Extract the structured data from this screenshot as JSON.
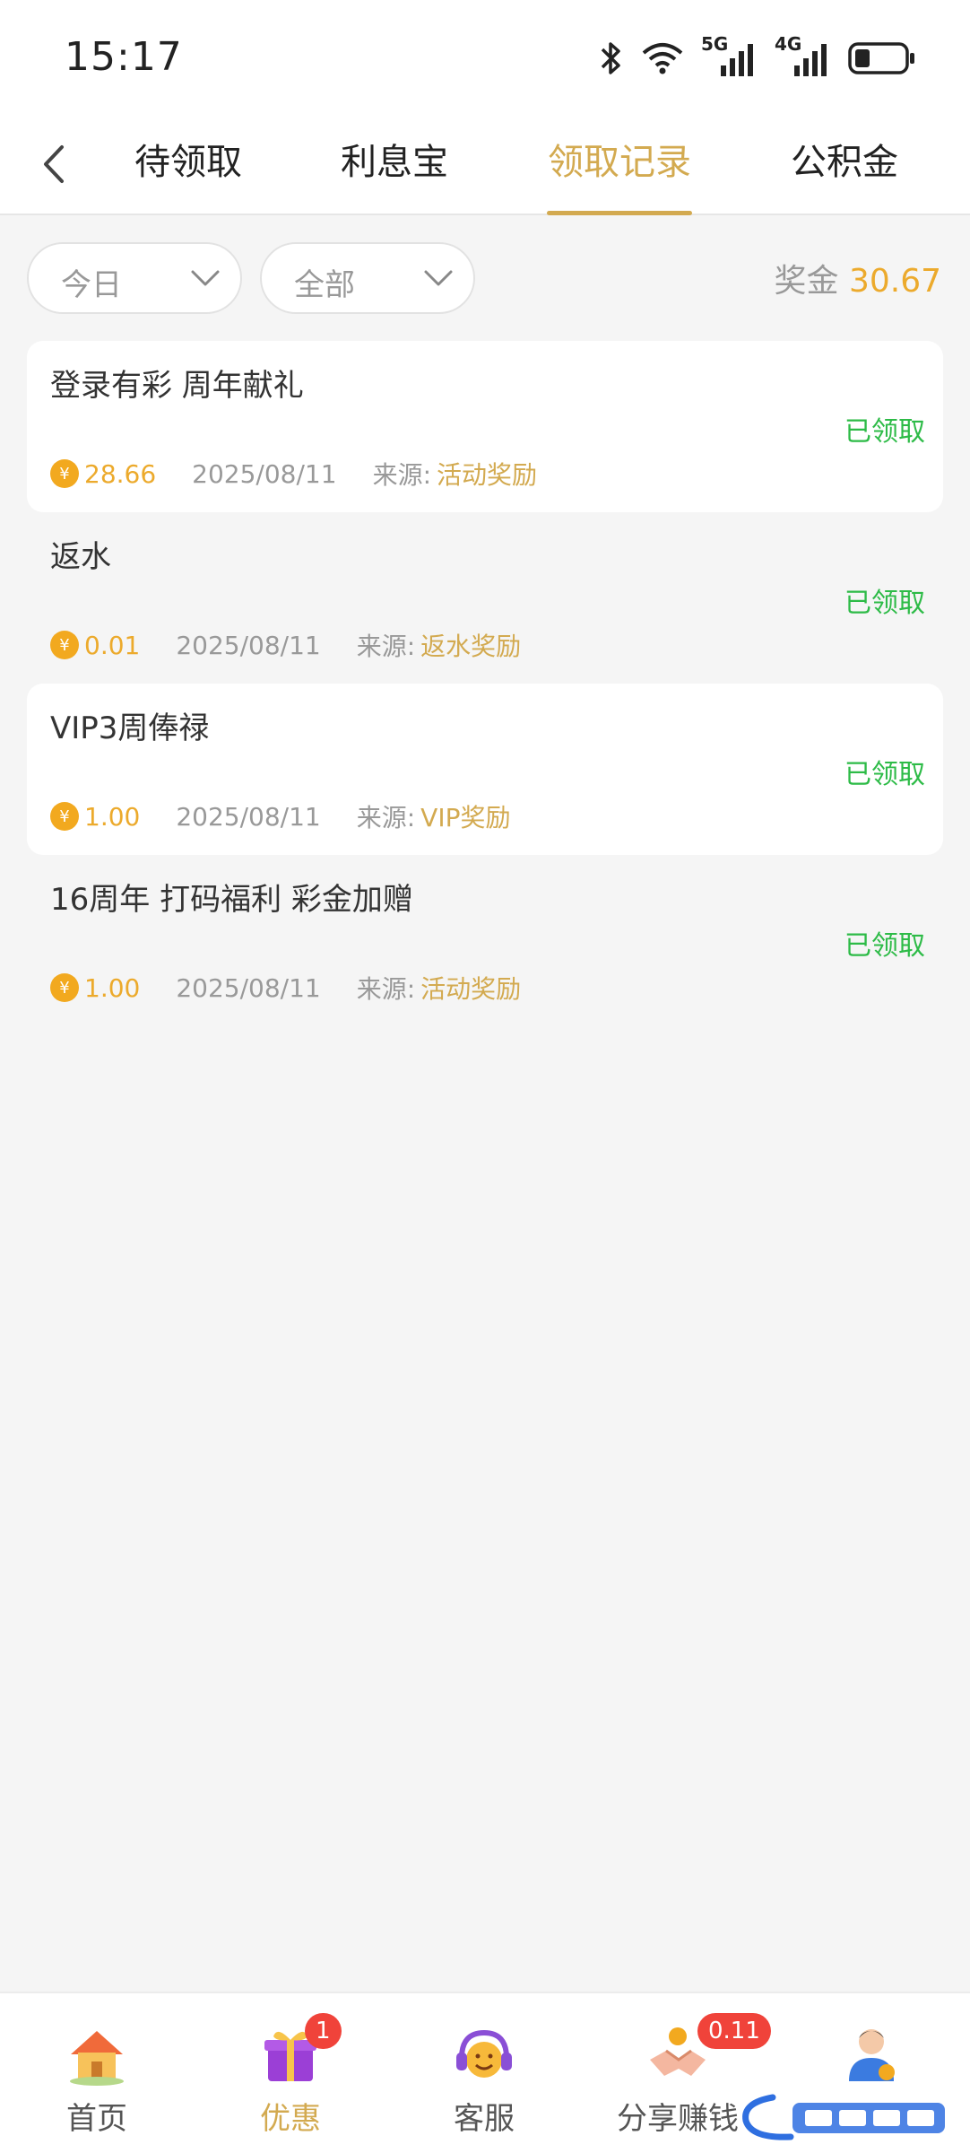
{
  "status_bar": {
    "time": "15:17",
    "network_5g": "5G",
    "network_4g": "4G"
  },
  "header": {
    "tabs": [
      {
        "label": "待领取",
        "active": false
      },
      {
        "label": "利息宝",
        "active": false
      },
      {
        "label": "领取记录",
        "active": true
      },
      {
        "label": "公积金",
        "active": false
      }
    ]
  },
  "filters": {
    "date_value": "今日",
    "type_value": "全部",
    "bonus_label": "奖金",
    "bonus_amount": "30.67"
  },
  "records": [
    {
      "title": "登录有彩  周年献礼",
      "status": "已领取",
      "amount": "28.66",
      "date": "2025/08/11",
      "source_label": "来源:",
      "source": "活动奖励"
    },
    {
      "title": "返水",
      "status": "已领取",
      "amount": "0.01",
      "date": "2025/08/11",
      "source_label": "来源:",
      "source": "返水奖励"
    },
    {
      "title": "VIP3周俸禄",
      "status": "已领取",
      "amount": "1.00",
      "date": "2025/08/11",
      "source_label": "来源:",
      "source": "VIP奖励"
    },
    {
      "title": "16周年 打码福利  彩金加赠",
      "status": "已领取",
      "amount": "1.00",
      "date": "2025/08/11",
      "source_label": "来源:",
      "source": "活动奖励"
    }
  ],
  "coin_symbol": "¥",
  "bottom_nav": {
    "items": [
      {
        "label": "首页",
        "icon": "home-icon"
      },
      {
        "label": "优惠",
        "icon": "gift-icon",
        "badge": "1"
      },
      {
        "label": "客服",
        "icon": "support-icon"
      },
      {
        "label": "分享赚钱",
        "icon": "handshake-icon",
        "badge": "0.11"
      },
      {
        "label": "",
        "icon": "profile-icon"
      }
    ]
  },
  "colors": {
    "accent": "#d3aa50",
    "amount": "#ecaa2c",
    "success": "#2dbb47",
    "badge": "#f0433a"
  }
}
